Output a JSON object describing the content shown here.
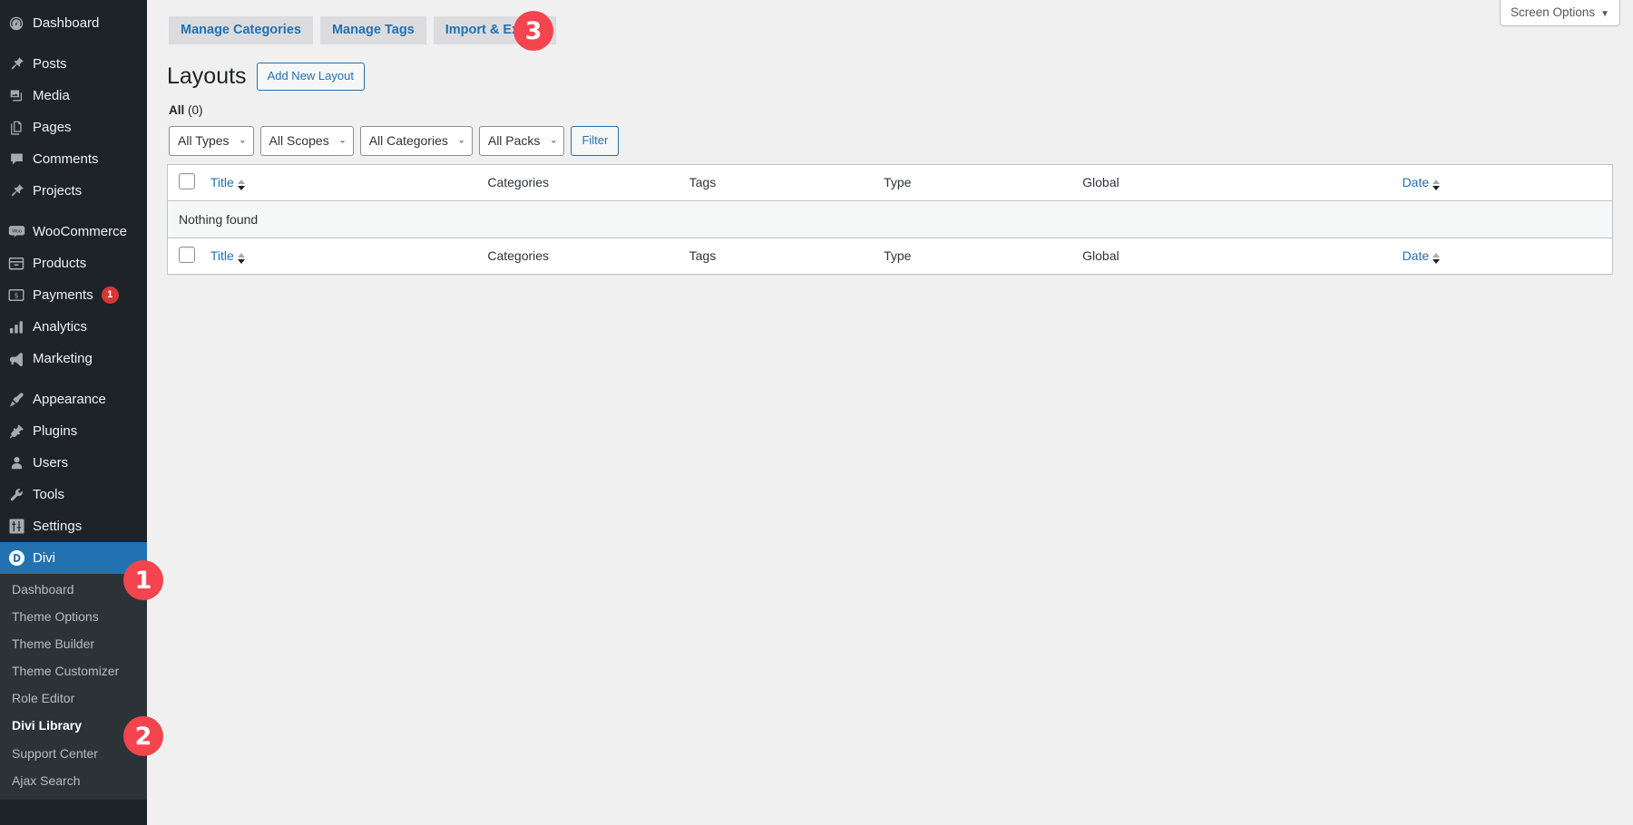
{
  "sidebar": {
    "items": [
      {
        "label": "Dashboard",
        "icon": "dashboard-icon",
        "active": false
      },
      {
        "label": "Posts",
        "icon": "pin-icon",
        "active": false
      },
      {
        "label": "Media",
        "icon": "media-icon",
        "active": false
      },
      {
        "label": "Pages",
        "icon": "pages-icon",
        "active": false
      },
      {
        "label": "Comments",
        "icon": "comments-icon",
        "active": false
      },
      {
        "label": "Projects",
        "icon": "pin-icon",
        "active": false
      },
      {
        "label": "WooCommerce",
        "icon": "woo-icon",
        "active": false
      },
      {
        "label": "Products",
        "icon": "products-icon",
        "active": false
      },
      {
        "label": "Payments",
        "icon": "payments-icon",
        "active": false,
        "count": "1"
      },
      {
        "label": "Analytics",
        "icon": "analytics-icon",
        "active": false
      },
      {
        "label": "Marketing",
        "icon": "megaphone-icon",
        "active": false
      },
      {
        "label": "Appearance",
        "icon": "brush-icon",
        "active": false
      },
      {
        "label": "Plugins",
        "icon": "plug-icon",
        "active": false
      },
      {
        "label": "Users",
        "icon": "user-icon",
        "active": false
      },
      {
        "label": "Tools",
        "icon": "wrench-icon",
        "active": false
      },
      {
        "label": "Settings",
        "icon": "settings-icon",
        "active": false
      },
      {
        "label": "Divi",
        "icon": "divi-icon",
        "active": true
      }
    ],
    "submenu": [
      {
        "label": "Dashboard",
        "current": false
      },
      {
        "label": "Theme Options",
        "current": false
      },
      {
        "label": "Theme Builder",
        "current": false
      },
      {
        "label": "Theme Customizer",
        "current": false
      },
      {
        "label": "Role Editor",
        "current": false
      },
      {
        "label": "Divi Library",
        "current": true
      },
      {
        "label": "Support Center",
        "current": false
      },
      {
        "label": "Ajax Search",
        "current": false
      }
    ]
  },
  "header": {
    "screen_options_label": "Screen Options",
    "screen_options_caret": "▼"
  },
  "nav_tabs": [
    {
      "label": "Manage Categories"
    },
    {
      "label": "Manage Tags"
    },
    {
      "label": "Import & Export"
    }
  ],
  "page": {
    "title": "Layouts",
    "add_new_label": "Add New Layout",
    "views": {
      "all_label": "All",
      "all_count": "(0)"
    }
  },
  "filters": {
    "selects": [
      {
        "name": "type-filter",
        "value": "All Types"
      },
      {
        "name": "scope-filter",
        "value": "All Scopes"
      },
      {
        "name": "category-filter",
        "value": "All Categories"
      },
      {
        "name": "pack-filter",
        "value": "All Packs"
      }
    ],
    "filter_button": "Filter",
    "chevron": "⌄"
  },
  "table": {
    "columns": {
      "title": "Title",
      "categories": "Categories",
      "tags": "Tags",
      "type": "Type",
      "global": "Global",
      "date": "Date"
    },
    "empty_message": "Nothing found"
  },
  "annotations": [
    {
      "id": "badge-1",
      "number": "1"
    },
    {
      "id": "badge-2",
      "number": "2"
    },
    {
      "id": "badge-3",
      "number": "3"
    }
  ],
  "colors": {
    "sidebar_bg": "#1d2327",
    "submenu_bg": "#2c3338",
    "accent_blue": "#2271b1",
    "badge_red": "#f4444e",
    "count_bubble_red": "#d63638",
    "content_bg": "#f0f0f1"
  }
}
